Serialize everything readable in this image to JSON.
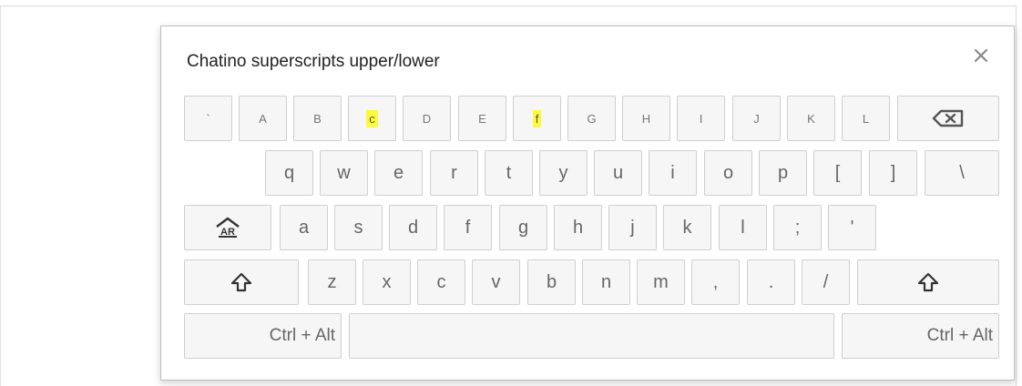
{
  "dialog": {
    "title": "Chatino superscripts upper/lower",
    "close_icon": "close-icon"
  },
  "rows": {
    "row1": [
      "`",
      "A",
      "B",
      "c",
      "D",
      "E",
      "f",
      "G",
      "H",
      "I",
      "J",
      "K",
      "L"
    ],
    "row1_highlighted": [
      "c",
      "f"
    ],
    "row2": [
      "q",
      "w",
      "e",
      "r",
      "t",
      "y",
      "u",
      "i",
      "o",
      "p",
      "[",
      "]",
      "\\"
    ],
    "row3": [
      "a",
      "s",
      "d",
      "f",
      "g",
      "h",
      "j",
      "k",
      "l",
      ";",
      "'"
    ],
    "row4": [
      "z",
      "x",
      "c",
      "v",
      "b",
      "n",
      "m",
      ",",
      ".",
      "/"
    ],
    "ctrl_alt_left": "Ctrl + Alt",
    "ctrl_alt_right": "Ctrl + Alt"
  },
  "icons": {
    "backspace": "backspace-icon",
    "alt_gr": "altgr-icon",
    "shift": "shift-icon"
  },
  "colors": {
    "highlight": "#fdfa3c",
    "key_bg": "#f6f6f6",
    "key_border": "#cfcfcf"
  }
}
